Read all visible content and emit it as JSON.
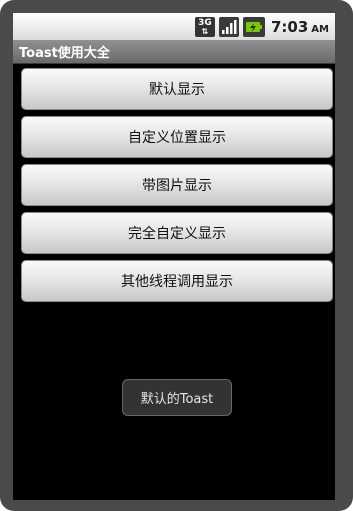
{
  "status_bar": {
    "network_icon": "3g-data-icon",
    "network_label": "3G",
    "signal_icon": "signal-bars-icon",
    "battery_icon": "battery-charging-icon",
    "time": "7:03",
    "ampm": "AM"
  },
  "app": {
    "title": "Toast使用大全"
  },
  "buttons": [
    {
      "label": "默认显示"
    },
    {
      "label": "自定义位置显示"
    },
    {
      "label": "带图片显示"
    },
    {
      "label": "完全自定义显示"
    },
    {
      "label": "其他线程调用显示"
    }
  ],
  "toast": {
    "text": "默认的Toast"
  }
}
